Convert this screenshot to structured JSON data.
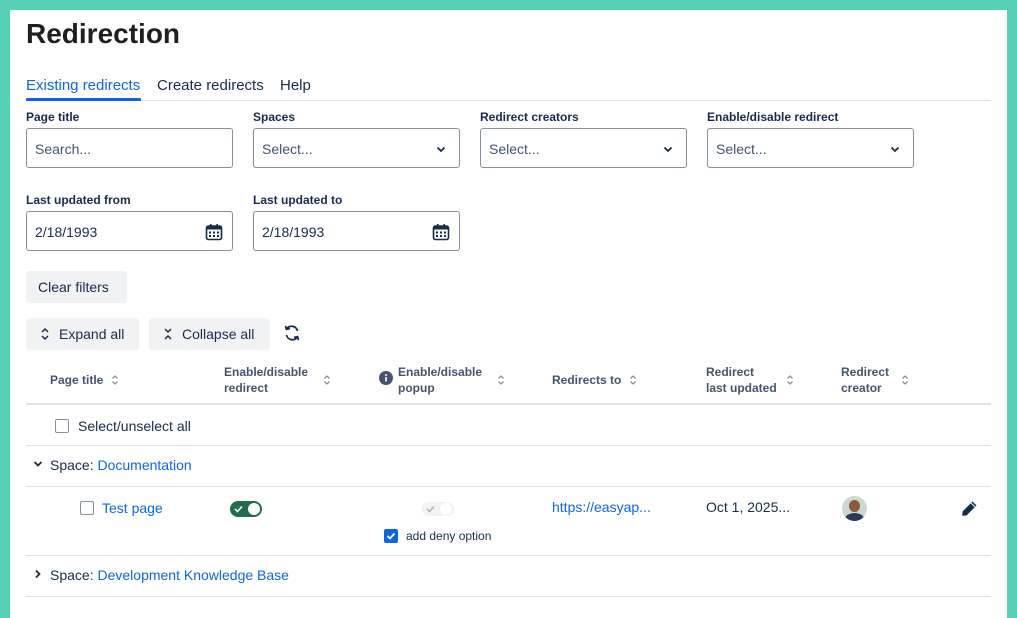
{
  "page": {
    "title": "Redirection"
  },
  "tabs": [
    {
      "label": "Existing redirects"
    },
    {
      "label": "Create redirects"
    },
    {
      "label": "Help"
    }
  ],
  "filters": {
    "page_title_label": "Page title",
    "page_title_placeholder": "Search...",
    "spaces_label": "Spaces",
    "spaces_value": "Select...",
    "creators_label": "Redirect creators",
    "creators_value": "Select...",
    "enable_label": "Enable/disable redirect",
    "enable_value": "Select...",
    "from_label": "Last updated from",
    "from_value": "2/18/1993",
    "to_label": "Last updated to",
    "to_value": "2/18/1993",
    "clear_label": "Clear filters"
  },
  "toolbar": {
    "expand_label": "Expand all",
    "collapse_label": "Collapse all"
  },
  "table": {
    "headers": {
      "page_title": "Page title",
      "enable_redirect_1": "Enable/disable",
      "enable_redirect_2": "redirect",
      "enable_popup_1": "Enable/disable",
      "enable_popup_2": "popup",
      "redirects_to": "Redirects to",
      "last_updated_1": "Redirect",
      "last_updated_2": "last updated",
      "creator_1": "Redirect",
      "creator_2": "creator"
    },
    "select_all_label": "Select/unselect all",
    "groups": [
      {
        "prefix": "Space:",
        "name": "Documentation",
        "expanded": true,
        "rows": [
          {
            "page": "Test page",
            "redirect_enabled": true,
            "popup_enabled": false,
            "deny_option_label": "add deny option",
            "deny_checked": true,
            "redirects_to": "https://easyap...",
            "last_updated": "Oct 1, 2025..."
          }
        ]
      },
      {
        "prefix": "Space:",
        "name": "Development Knowledge Base",
        "expanded": false
      }
    ]
  },
  "colors": {
    "accent": "#0c66e4",
    "toggle_on": "#216e4e",
    "frame": "#57d1b3"
  }
}
